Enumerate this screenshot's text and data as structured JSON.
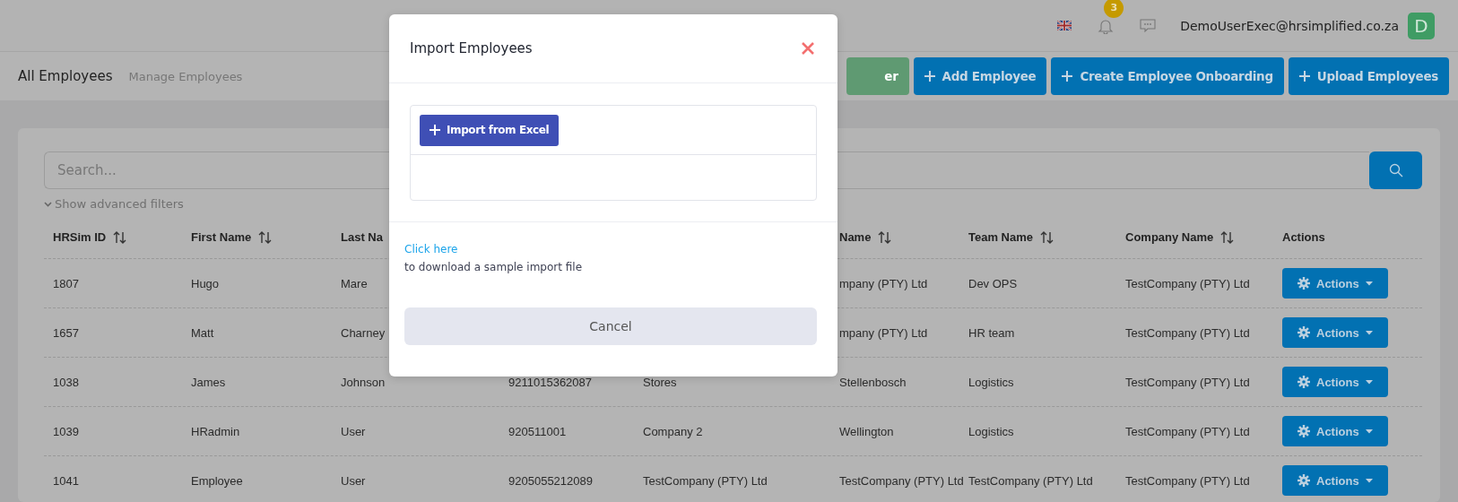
{
  "top_bar": {
    "notification_count": "3",
    "user_email": "DemoUserExec@hrsimplified.co.za",
    "avatar_initial": "D"
  },
  "page_header": {
    "title": "All Employees",
    "subtitle": "Manage Employees",
    "buttons": [
      {
        "label": "er",
        "color": "#5f9a72",
        "icon": false
      },
      {
        "label": "Add Employee",
        "color": "#0271b2",
        "icon": true
      },
      {
        "label": "Create Employee Onboarding",
        "color": "#0271b2",
        "icon": true
      },
      {
        "label": "Upload Employees",
        "color": "#0271b2",
        "icon": true
      }
    ]
  },
  "search": {
    "placeholder": "Search..."
  },
  "filters_toggle": "Show advanced filters",
  "table": {
    "columns": [
      {
        "label": "HRSim ID",
        "sortable": true
      },
      {
        "label": "First Name",
        "sortable": true
      },
      {
        "label": "Last Na",
        "sortable": false
      },
      null,
      null,
      {
        "label": "Name",
        "sortable": true
      },
      {
        "label": "Team Name",
        "sortable": true
      },
      {
        "label": "Company Name",
        "sortable": true
      },
      {
        "label": "Actions",
        "sortable": false
      }
    ],
    "rows": [
      {
        "cells": [
          "1807",
          "Hugo",
          "Mare",
          null,
          null,
          "mpany (PTY) Ltd",
          "Dev OPS",
          "TestCompany (PTY) Ltd"
        ],
        "action": "Actions"
      },
      {
        "cells": [
          "1657",
          "Matt",
          "Charney",
          null,
          null,
          "mpany (PTY) Ltd",
          "HR team",
          "TestCompany (PTY) Ltd"
        ],
        "action": "Actions"
      },
      {
        "cells": [
          "1038",
          "James",
          "Johnson",
          "9211015362087",
          "Stores",
          "Stellenbosch",
          "Logistics",
          "TestCompany (PTY) Ltd"
        ],
        "action": "Actions"
      },
      {
        "cells": [
          "1039",
          "HRadmin",
          "User",
          "920511001",
          "Company 2",
          "Wellington",
          "Logistics",
          "TestCompany (PTY) Ltd"
        ],
        "action": "Actions"
      },
      {
        "cells": [
          "1041",
          "Employee",
          "User",
          "9205055212089",
          "TestCompany (PTY) Ltd",
          "TestCompany (PTY) Ltd",
          "TestCompany (PTY) Ltd",
          "TestCompany (PTY) Ltd"
        ],
        "action": "Actions"
      }
    ]
  },
  "modal": {
    "title": "Import Employees",
    "import_button": "Import from Excel",
    "download_link": "Click here",
    "download_note": "to download a sample import file",
    "cancel_button": "Cancel"
  }
}
